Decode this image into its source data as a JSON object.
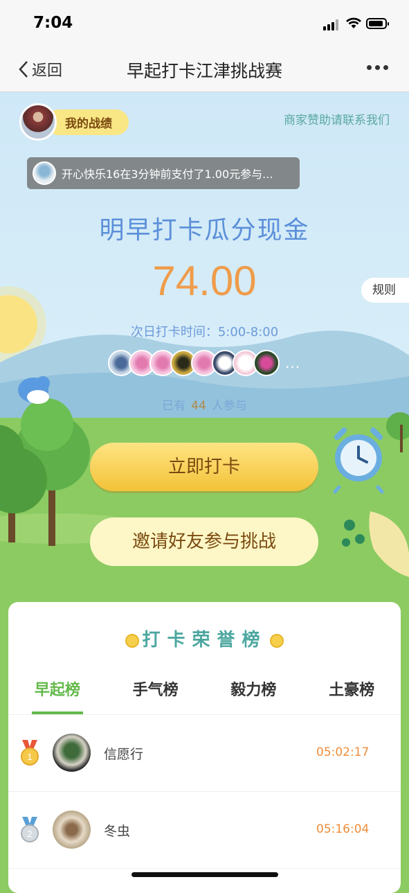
{
  "status": {
    "time": "7:04"
  },
  "nav": {
    "back_label": "返回",
    "title": "早起打卡江津挑战赛"
  },
  "header": {
    "my_record": "我的战绩",
    "sponsor": "商家赞助请联系我们"
  },
  "ticker": {
    "text": "开心快乐16在3分钟前支付了1.00元参与..."
  },
  "prize": {
    "headline": "明早打卡瓜分现金",
    "amount": "74.00",
    "rules": "规则",
    "time_label": "次日打卡时间：5:00-8:00",
    "joined_prefix": "已有",
    "joined_count": "44",
    "joined_suffix": "人参与",
    "more": "..."
  },
  "buttons": {
    "checkin": "立即打卡",
    "invite": "邀请好友参与挑战"
  },
  "leaderboard": {
    "title": "打卡荣誉榜",
    "tabs": [
      "早起榜",
      "手气榜",
      "毅力榜",
      "土豪榜"
    ],
    "rows": [
      {
        "rank": "1",
        "name": "信愿行",
        "time": "05:02:17"
      },
      {
        "rank": "2",
        "name": "冬虫",
        "time": "05:16:04"
      }
    ]
  },
  "colors": {
    "accent": "#63b94a",
    "amount": "#ef9c4b",
    "headline": "#5b8fd9"
  }
}
